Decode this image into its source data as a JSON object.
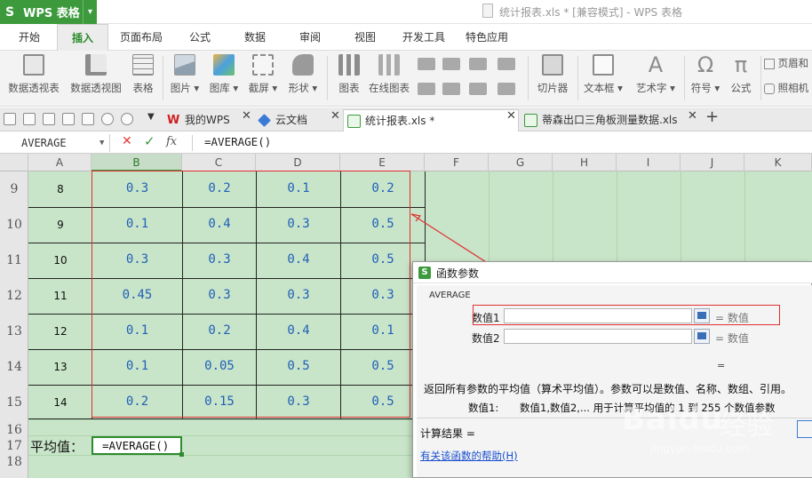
{
  "app": {
    "name": "WPS 表格",
    "logo": "S",
    "window_title": "统计报表.xls * [兼容模式] - WPS 表格"
  },
  "ribbon_tabs": [
    "开始",
    "插入",
    "页面布局",
    "公式",
    "数据",
    "审阅",
    "视图",
    "开发工具",
    "特色应用"
  ],
  "active_tab": "插入",
  "ribbon_buttons": [
    {
      "label": "数据透视表",
      "icon": "pivot-table-icon"
    },
    {
      "label": "数据透视图",
      "icon": "pivot-chart-icon"
    },
    {
      "label": "表格",
      "icon": "table-icon"
    },
    {
      "label": "图片 ▾",
      "icon": "picture-icon"
    },
    {
      "label": "图库 ▾",
      "icon": "gallery-icon"
    },
    {
      "label": "截屏 ▾",
      "icon": "screenshot-icon"
    },
    {
      "label": "形状 ▾",
      "icon": "shapes-icon"
    },
    {
      "label": "图表",
      "icon": "chart-icon"
    },
    {
      "label": "在线图表",
      "icon": "online-chart-icon"
    },
    {
      "label": "切片器",
      "icon": "slicer-icon"
    },
    {
      "label": "文本框 ▾",
      "icon": "textbox-icon"
    },
    {
      "label": "艺术字 ▾",
      "icon": "wordart-icon"
    },
    {
      "label": "符号 ▾",
      "icon": "symbol-icon"
    },
    {
      "label": "公式",
      "icon": "formula-icon"
    }
  ],
  "ribbon_right": {
    "header_footer": "页眉和",
    "camera": "照相机"
  },
  "doc_tabs": [
    {
      "label": "我的WPS",
      "icon": "wps-home-icon"
    },
    {
      "label": "云文档",
      "icon": "cloud-doc-icon"
    },
    {
      "label": "统计报表.xls *",
      "icon": "xls-file-icon",
      "active": true
    },
    {
      "label": "蒂森出口三角板测量数据.xls",
      "icon": "xls-file-icon"
    }
  ],
  "formula_bar": {
    "name_box": "AVERAGE",
    "cancel": "✕",
    "enter": "✓",
    "fx": "fx",
    "formula": "=AVERAGE()"
  },
  "columns": [
    "A",
    "B",
    "C",
    "D",
    "E",
    "F",
    "G",
    "H",
    "I",
    "J",
    "K"
  ],
  "selected_column": "B",
  "rows": [
    {
      "num": "9",
      "a": "8",
      "b": "0.3",
      "c": "0.2",
      "d": "0.1",
      "e": "0.2"
    },
    {
      "num": "10",
      "a": "9",
      "b": "0.1",
      "c": "0.4",
      "d": "0.3",
      "e": "0.5"
    },
    {
      "num": "11",
      "a": "10",
      "b": "0.3",
      "c": "0.3",
      "d": "0.4",
      "e": "0.5"
    },
    {
      "num": "12",
      "a": "11",
      "b": "0.45",
      "c": "0.3",
      "d": "0.3",
      "e": "0.3"
    },
    {
      "num": "13",
      "a": "12",
      "b": "0.1",
      "c": "0.2",
      "d": "0.4",
      "e": "0.1"
    },
    {
      "num": "14",
      "a": "13",
      "b": "0.1",
      "c": "0.05",
      "d": "0.5",
      "e": "0.5"
    },
    {
      "num": "15",
      "a": "14",
      "b": "0.2",
      "c": "0.15",
      "d": "0.3",
      "e": "0.5"
    }
  ],
  "extra_rows": [
    "16",
    "17",
    "18"
  ],
  "average_row": {
    "label": "平均值：",
    "formula": "=AVERAGE()"
  },
  "dialog": {
    "title": "函数参数",
    "function_name": "AVERAGE",
    "params": [
      {
        "label": "数值1",
        "value": "",
        "hint": "= 数值"
      },
      {
        "label": "数值2",
        "value": "",
        "hint": "= 数值"
      }
    ],
    "result_eq": "=",
    "description": "返回所有参数的平均值（算术平均值）。参数可以是数值、名称、数组、引用。",
    "param_desc_label": "数值1:",
    "param_desc": "数值1,数值2,...  用于计算平均值的 1 到 255 个数值参数",
    "calc_result": "计算结果 =",
    "help_link": "有关该函数的帮助(H)"
  },
  "watermark": {
    "logo": "Baidu",
    "sub": "jingyan.baidu.com",
    "chinese": "经验"
  },
  "colors": {
    "accent": "#3c9a3c",
    "grid_bg": "#c9e5c9",
    "number_text": "#1f5fb8",
    "highlight_red": "#e03030"
  }
}
